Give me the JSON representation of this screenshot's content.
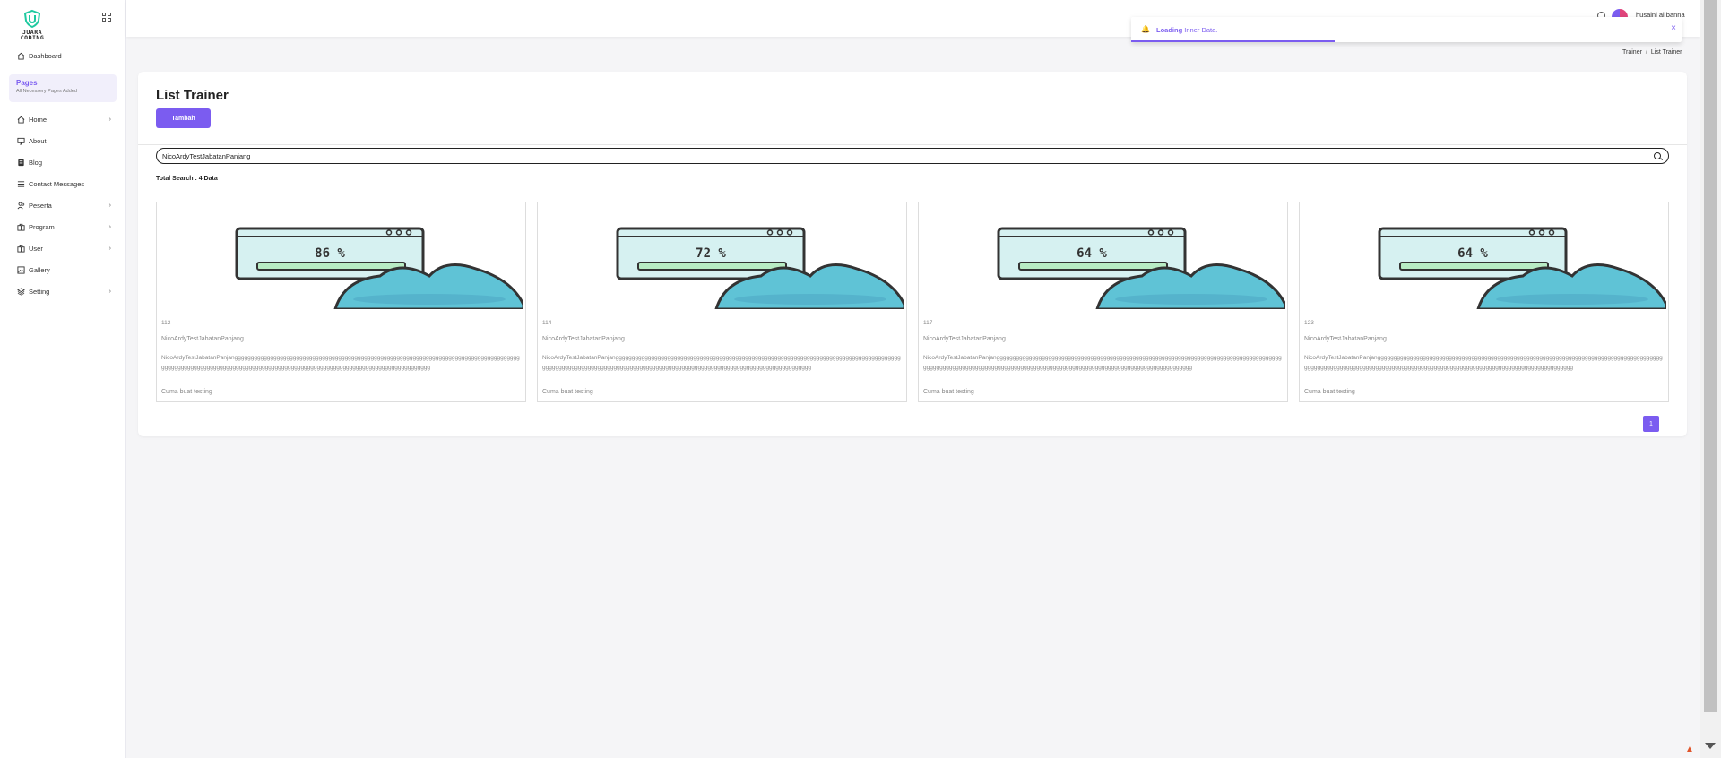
{
  "brand": {
    "line1": "JUARA",
    "line2": "CODING"
  },
  "sidebar": {
    "items": [
      {
        "label": "Dashboard",
        "icon": "home-icon",
        "chevron": false
      },
      {
        "label": "Home",
        "icon": "home-icon",
        "chevron": true
      },
      {
        "label": "About",
        "icon": "monitor-icon",
        "chevron": false
      },
      {
        "label": "Blog",
        "icon": "blog-icon",
        "chevron": false
      },
      {
        "label": "Contact Messages",
        "icon": "list-icon",
        "chevron": false
      },
      {
        "label": "Peserta",
        "icon": "users-icon",
        "chevron": true
      },
      {
        "label": "Program",
        "icon": "briefcase-icon",
        "chevron": true
      },
      {
        "label": "User",
        "icon": "briefcase-icon",
        "chevron": true
      },
      {
        "label": "Gallery",
        "icon": "image-icon",
        "chevron": false
      },
      {
        "label": "Setting",
        "icon": "layers-icon",
        "chevron": true
      }
    ],
    "pages": {
      "title": "Pages",
      "subtitle": "All Necessery Pages Added"
    }
  },
  "topbar": {
    "username": "husaini al banna"
  },
  "toast": {
    "bold": "Loading",
    "text": "Inner Data.",
    "close": "×",
    "progress": 0.37
  },
  "breadcrumb": {
    "parent": "Trainer",
    "sep": "/",
    "current": "List Trainer"
  },
  "main": {
    "title": "List Trainer",
    "add_label": "Tambah",
    "search_value": "NicoArdyTestJabatanPanjang",
    "total": "Total Search : 4 Data",
    "page_number": "1"
  },
  "trainers": [
    {
      "id": "112",
      "name": "NicoArdyTestJabatanPanjang",
      "percent": "86 %",
      "description": "NicoArdyTestJabatanPanjanggggggggggggggggggggggggggggggggggggggggggggggggggggggggggggggggggggggggggggggggggggggggggggggggggggggggggggggggggggggggggggggggggggggggggggggggggggggggggggggggggggggggggg",
      "note": "Cuma buat testing"
    },
    {
      "id": "114",
      "name": "NicoArdyTestJabatanPanjang",
      "percent": "72 %",
      "description": "NicoArdyTestJabatanPanjanggggggggggggggggggggggggggggggggggggggggggggggggggggggggggggggggggggggggggggggggggggggggggggggggggggggggggggggggggggggggggggggggggggggggggggggggggggggggggggggggggggggggggg",
      "note": "Cuma buat testing"
    },
    {
      "id": "117",
      "name": "NicoArdyTestJabatanPanjang",
      "percent": "64 %",
      "description": "NicoArdyTestJabatanPanjanggggggggggggggggggggggggggggggggggggggggggggggggggggggggggggggggggggggggggggggggggggggggggggggggggggggggggggggggggggggggggggggggggggggggggggggggggggggggggggggggggggggggggg",
      "note": "Cuma buat testing"
    },
    {
      "id": "123",
      "name": "NicoArdyTestJabatanPanjang",
      "percent": "64 %",
      "description": "NicoArdyTestJabatanPanjanggggggggggggggggggggggggggggggggggggggggggggggggggggggggggggggggggggggggggggggggggggggggggggggggggggggggggggggggggggggggggggggggggggggggggggggggggggggggggggggggggggggggggg",
      "note": "Cuma buat testing"
    }
  ],
  "colors": {
    "accent": "#7b5cf0",
    "illustration_screen": "#d6f1f1",
    "illustration_blob": "#5fc3d6"
  }
}
